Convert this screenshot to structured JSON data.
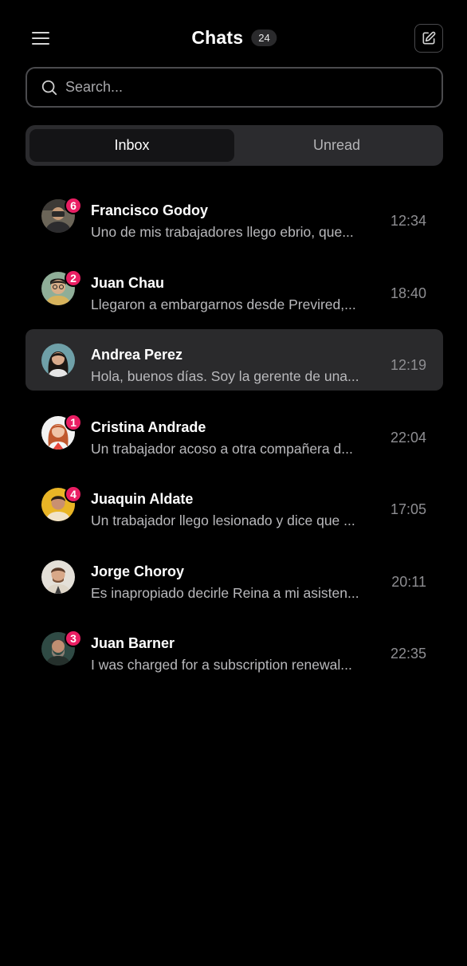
{
  "header": {
    "title": "Chats",
    "count": "24",
    "menu_icon": "hamburger-menu-icon",
    "compose_icon": "compose-icon"
  },
  "search": {
    "placeholder": "Search...",
    "value": "",
    "icon": "search-icon"
  },
  "tabs": [
    {
      "label": "Inbox",
      "active": true
    },
    {
      "label": "Unread",
      "active": false
    }
  ],
  "colors": {
    "background": "#000000",
    "badge": "#ea1e63",
    "selected_row": "#2a2a2c",
    "tab_bar": "#2b2b2e",
    "active_tab": "#141416"
  },
  "chats": [
    {
      "name": "Francisco Godoy",
      "preview": "Uno de mis trabajadores llego ebrio, que...",
      "time": "12:34",
      "unread": "6",
      "selected": false
    },
    {
      "name": "Juan Chau",
      "preview": "Llegaron a embargarnos desde Previred,...",
      "time": "18:40",
      "unread": "2",
      "selected": false
    },
    {
      "name": "Andrea Perez",
      "preview": "Hola, buenos días. Soy la gerente de una...",
      "time": "12:19",
      "unread": "",
      "selected": true
    },
    {
      "name": "Cristina Andrade",
      "preview": "Un trabajador acoso a otra compañera d...",
      "time": "22:04",
      "unread": "1",
      "selected": false
    },
    {
      "name": "Juaquin Aldate",
      "preview": "Un trabajador llego lesionado y dice que ...",
      "time": "17:05",
      "unread": "4",
      "selected": false
    },
    {
      "name": "Jorge Choroy",
      "preview": "Es inapropiado decirle Reina a mi asisten...",
      "time": "20:11",
      "unread": "",
      "selected": false
    },
    {
      "name": "Juan Barner",
      "preview": "I was charged for a subscription renewal...",
      "time": "22:35",
      "unread": "3",
      "selected": false
    }
  ]
}
